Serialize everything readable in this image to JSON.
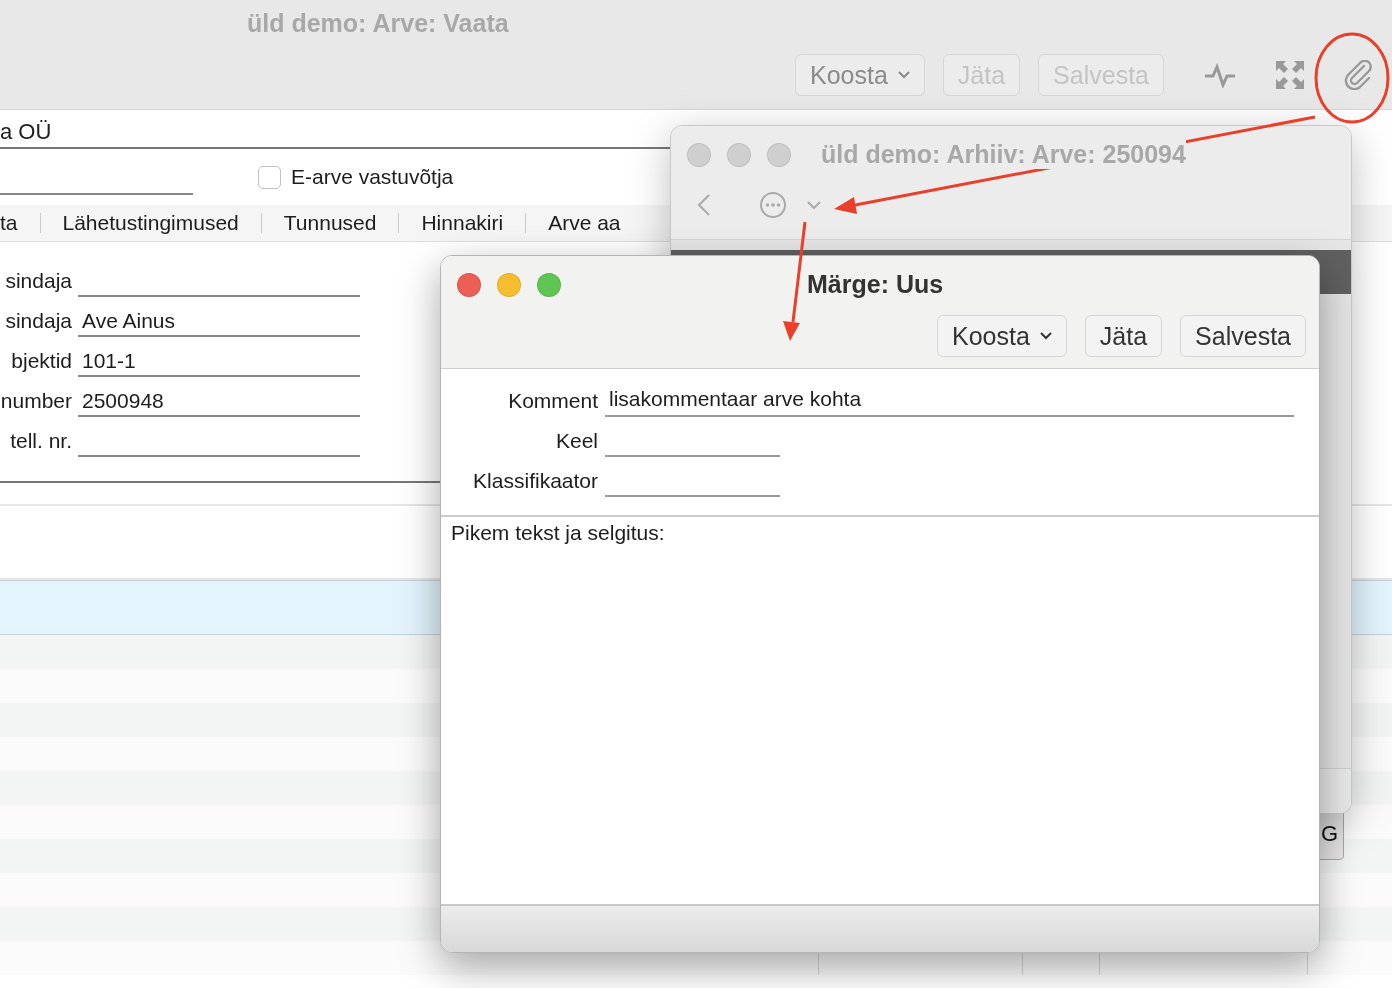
{
  "main_window": {
    "title": "üld demo: Arve: Vaata",
    "active": false,
    "toolbar": [
      {
        "label": "Koosta",
        "kind": "menu",
        "disabled": false
      },
      {
        "label": "Jäta",
        "kind": "plain",
        "disabled": true
      },
      {
        "label": "Salvesta",
        "kind": "plain",
        "disabled": true
      }
    ],
    "company": "a OÜ",
    "e_invoice": {
      "label": "E-arve vastuvõtja",
      "checked": false
    },
    "tabs": [
      "ta",
      "Lähetustingimused",
      "Tunnused",
      "Hinnakiri",
      "Arve aa"
    ],
    "fields": [
      {
        "label": "sindaja"
      },
      {
        "label": "sindaja",
        "value": "Ave Ainus"
      },
      {
        "label": "bjektid",
        "value": "101-1"
      },
      {
        "label": "number",
        "value": "2500948"
      },
      {
        "label": "tell. nr."
      }
    ],
    "table": {
      "rows": [
        {
          "selected": true
        },
        {
          "selected": false
        },
        {
          "selected": false
        },
        {
          "selected": false
        },
        {
          "selected": false
        },
        {
          "selected": false
        },
        {
          "selected": false
        },
        {
          "selected": false
        },
        {
          "selected": false
        },
        {
          "selected": false
        },
        {
          "selected": false
        }
      ]
    },
    "partial_button": "G"
  },
  "archive_window": {
    "title": "üld demo: Arhiiv: Arve: 250094",
    "active": false
  },
  "note_dialog": {
    "title": "Märge: Uus",
    "active": true,
    "toolbar": [
      {
        "label": "Koosta",
        "kind": "menu",
        "disabled": false
      },
      {
        "label": "Jäta",
        "kind": "plain",
        "disabled": false
      },
      {
        "label": "Salvesta",
        "kind": "plain",
        "disabled": false
      }
    ],
    "fields": [
      {
        "label": "Komment",
        "value": "lisakommentaar arve kohta",
        "kind": "wide"
      },
      {
        "label": "Keel",
        "kind": "short"
      },
      {
        "label": "Klassifikaator",
        "kind": "short"
      }
    ],
    "long_text": "Pikem tekst ja selgitus:"
  }
}
